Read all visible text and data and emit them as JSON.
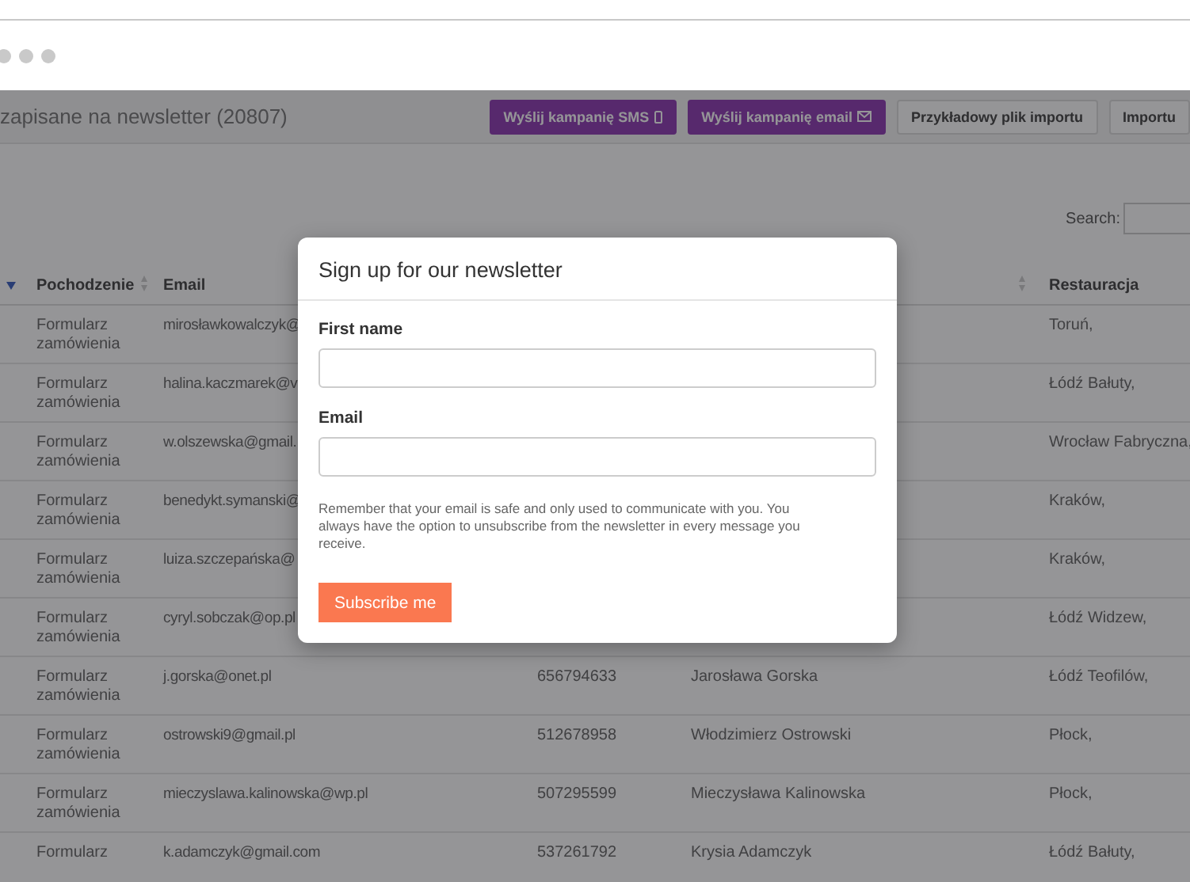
{
  "page": {
    "title": "zapisane na newsletter (20807)",
    "buttons": [
      {
        "label": "Wyślij kampanię SMS",
        "kind": "sms"
      },
      {
        "label": "Wyślij kampanię email",
        "kind": "email"
      },
      {
        "label": "Przykładowy plik importu",
        "kind": "plain"
      },
      {
        "label": "Importu",
        "kind": "plain"
      }
    ]
  },
  "search": {
    "label": "Search:"
  },
  "table": {
    "columns": [
      "Pochodzenie",
      "Email",
      "Restauracja"
    ],
    "rows": [
      {
        "origin": "Formularz zamówienia",
        "email": "mirosławkowalczyk@",
        "restaurant": "Toruń,"
      },
      {
        "origin": "Formularz zamówienia",
        "email": "halina.kaczmarek@v",
        "restaurant": "Łódź Bałuty,"
      },
      {
        "origin": "Formularz zamówienia",
        "email": "w.olszewska@gmail.",
        "restaurant": "Wrocław Fabryczna,"
      },
      {
        "origin": "Formularz zamówienia",
        "email": "benedykt.symanski@",
        "restaurant": "Kraków,"
      },
      {
        "origin": "Formularz zamówienia",
        "email": "luiza.szczepańska@",
        "restaurant": "Kraków,"
      },
      {
        "origin": "Formularz zamówienia",
        "email": "cyryl.sobczak@op.pl",
        "restaurant": "Łódź Widzew,"
      },
      {
        "origin": "Formularz zamówienia",
        "email": "j.gorska@onet.pl",
        "phone": "656794633",
        "name": "Jarosława Gorska",
        "restaurant": "Łódź Teofilów,"
      },
      {
        "origin": "Formularz zamówienia",
        "email": "ostrowski9@gmail.pl",
        "phone": "512678958",
        "name": "Włodzimierz Ostrowski",
        "restaurant": "Płock,"
      },
      {
        "origin": "Formularz zamówienia",
        "email": "mieczyslawa.kalinowska@wp.pl",
        "phone": "507295599",
        "name": "Mieczysława Kalinowska",
        "restaurant": "Płock,"
      },
      {
        "origin": "Formularz",
        "email": "k.adamczyk@gmail.com",
        "phone": "537261792",
        "name": "Krysia Adamczyk",
        "restaurant": "Łódź Bałuty,"
      }
    ]
  },
  "modal": {
    "title": "Sign up for our newsletter",
    "fields": [
      {
        "label": "First name"
      },
      {
        "label": "Email"
      }
    ],
    "note": "Remember that your email is safe and only used to communicate with you. You always have the option to unsubscribe from the newsletter in every message you receive.",
    "button": "Subscribe me"
  }
}
